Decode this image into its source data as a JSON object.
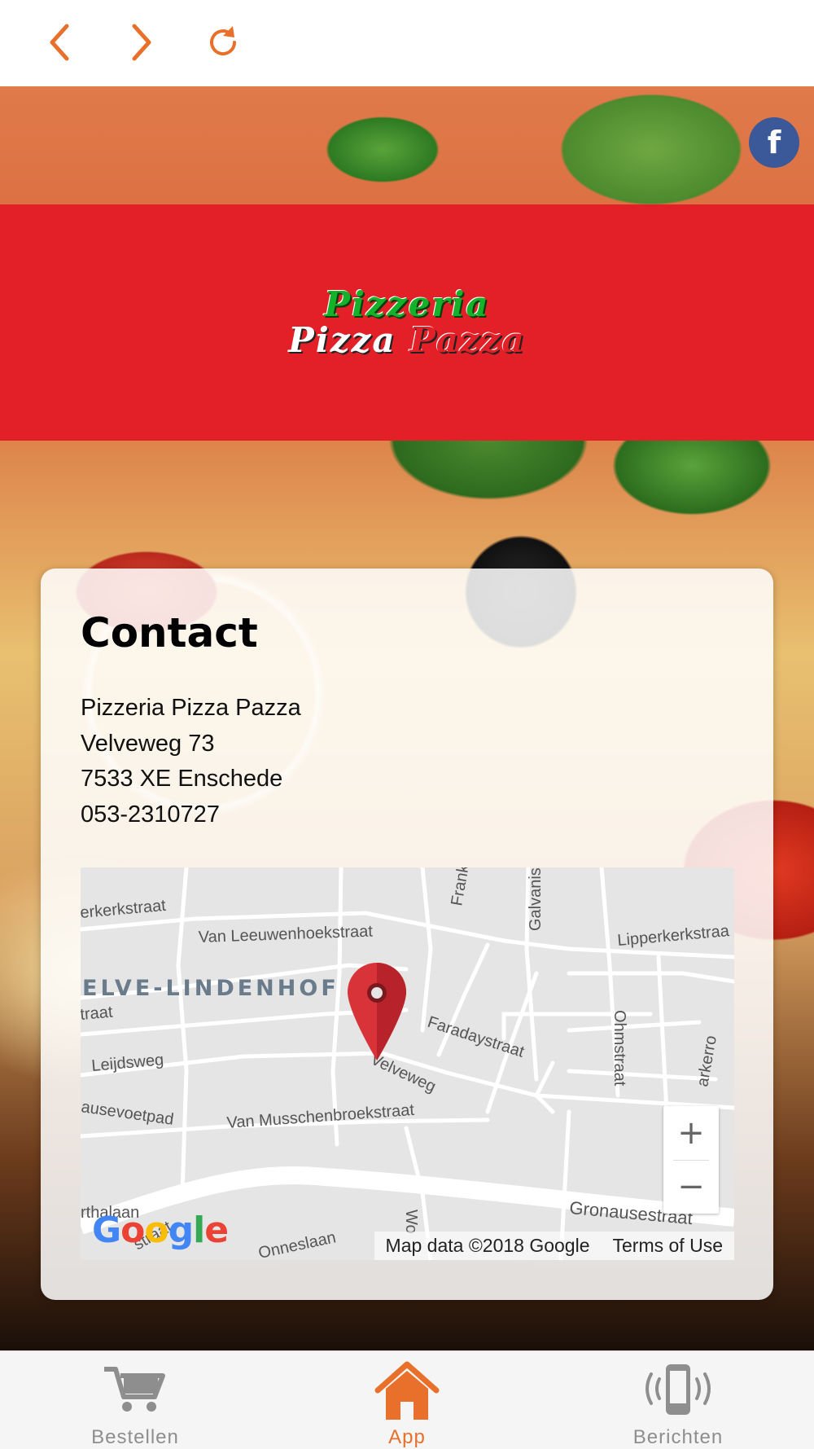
{
  "colors": {
    "accent": "#e8702a",
    "banner": "#e32027",
    "tab_inactive": "#8e8e8e",
    "facebook": "#3b5998"
  },
  "toolbar": {
    "back_icon": "chevron-left-icon",
    "forward_icon": "chevron-right-icon",
    "reload_icon": "reload-icon"
  },
  "header": {
    "logo_line1": "Pizzeria",
    "logo_line2_a": "Pizza",
    "logo_line2_b": "Pazza",
    "facebook_icon": "facebook-icon"
  },
  "contact": {
    "title": "Contact",
    "name": "Pizzeria Pizza Pazza",
    "street": "Velveweg 73",
    "city": "7533 XE Enschede",
    "phone": "053-2310727"
  },
  "map": {
    "streets": [
      "erkerkstraat",
      "Van Leeuwenhoekstraat",
      "Frank",
      "Galvanis",
      "Lipperkerkstraa",
      "ELVE-LINDENHOF",
      "traat",
      "Faradaystraat",
      "Ohmstraat",
      "Leijdsweg",
      "Velveweg",
      "arkerro",
      "ausevoetpad",
      "Van Musschenbroekstraat",
      "rthalaan",
      "straat",
      "Onneslaan",
      "Wo",
      "Gronausestraat"
    ],
    "zoom_in": "+",
    "zoom_out": "−",
    "google_logo": "Google",
    "attribution": "Map data ©2018 Google",
    "terms": "Terms of Use"
  },
  "tabs": [
    {
      "label": "Bestellen",
      "icon": "cart-icon",
      "active": false
    },
    {
      "label": "App",
      "icon": "home-icon",
      "active": true
    },
    {
      "label": "Berichten",
      "icon": "phone-vibrate-icon",
      "active": false
    }
  ]
}
